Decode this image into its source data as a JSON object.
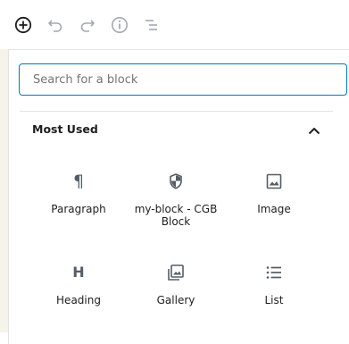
{
  "search": {
    "placeholder": "Search for a block"
  },
  "section": {
    "title": "Most Used"
  },
  "blocks": [
    {
      "label": "Paragraph",
      "icon": "paragraph-icon"
    },
    {
      "label": "my-block - CGB Block",
      "icon": "shield-icon"
    },
    {
      "label": "Image",
      "icon": "image-icon"
    },
    {
      "label": "Heading",
      "icon": "heading-icon"
    },
    {
      "label": "Gallery",
      "icon": "gallery-icon"
    },
    {
      "label": "List",
      "icon": "list-icon"
    }
  ],
  "colors": {
    "accent": "#007cba",
    "icon": "#555d66",
    "disabled": "#a2aab2"
  }
}
